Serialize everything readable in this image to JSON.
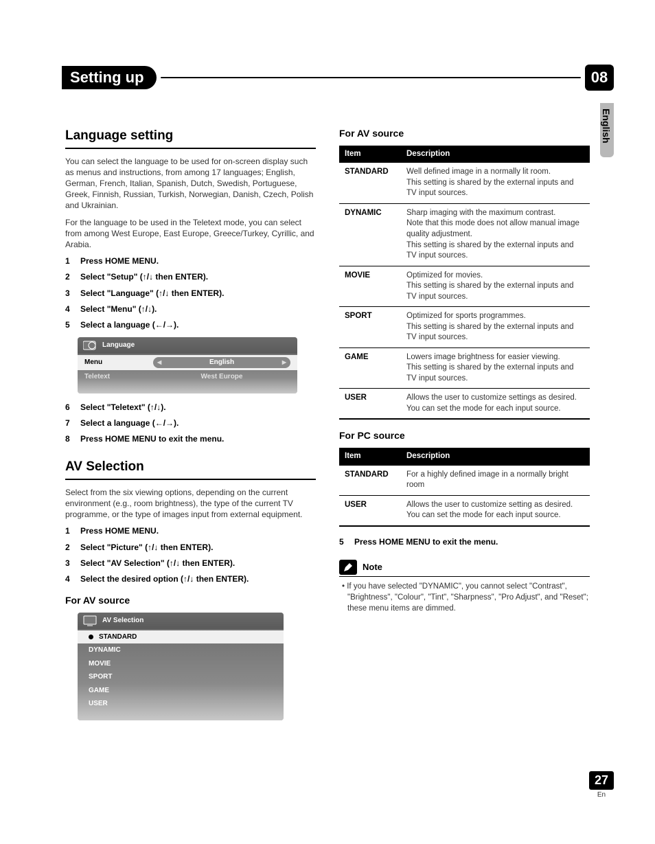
{
  "chapter": {
    "title": "Setting up",
    "number": "08"
  },
  "side_tab": "English",
  "language_setting": {
    "heading": "Language setting",
    "p1": "You can select the language to be used for on-screen display such as menus and instructions, from among 17 languages; English, German, French, Italian, Spanish, Dutch, Swedish, Portuguese, Greek, Finnish, Russian, Turkish, Norwegian, Danish, Czech, Polish and Ukrainian.",
    "p2": "For the language to be used in the Teletext mode, you can select from among West Europe, East Europe, Greece/Turkey, Cyrillic, and Arabia.",
    "steps": {
      "s1": "Press HOME MENU.",
      "s2": "Select \"Setup\" (↑/↓ then ENTER).",
      "s3": "Select \"Language\" (↑/↓ then ENTER).",
      "s4": "Select \"Menu\" (↑/↓).",
      "s5": "Select a language (←/→).",
      "s6": "Select \"Teletext\" (↑/↓).",
      "s7": "Select a language (←/→).",
      "s8": "Press HOME MENU to exit the menu."
    },
    "osd": {
      "title": "Language",
      "row1_label": "Menu",
      "row1_value": "English",
      "row2_label": "Teletext",
      "row2_value": "West Europe"
    }
  },
  "av_selection": {
    "heading": "AV Selection",
    "intro": "Select from the six viewing options, depending on the current environment (e.g., room brightness), the type of the current TV programme, or the type of images input from external equipment.",
    "steps": {
      "s1": "Press HOME MENU.",
      "s2": "Select \"Picture\" (↑/↓ then ENTER).",
      "s3": "Select \"AV Selection\" (↑/↓ then ENTER).",
      "s4": "Select the desired option (↑/↓ then ENTER)."
    },
    "sub_av": "For AV source",
    "osd": {
      "title": "AV Selection",
      "items": [
        "STANDARD",
        "DYNAMIC",
        "MOVIE",
        "SPORT",
        "GAME",
        "USER"
      ]
    }
  },
  "right": {
    "sub_av": "For AV source",
    "av_table": {
      "headers": {
        "item": "Item",
        "desc": "Description"
      },
      "rows": [
        {
          "item": "STANDARD",
          "desc": "Well defined image in a normally lit room.\nThis setting is shared by the external inputs and TV input sources."
        },
        {
          "item": "DYNAMIC",
          "desc": "Sharp imaging with the maximum contrast.\nNote that this mode does not allow manual image quality adjustment.\nThis setting is shared by the external inputs and TV input sources."
        },
        {
          "item": "MOVIE",
          "desc": "Optimized for movies.\nThis setting is shared by the external inputs and TV input sources."
        },
        {
          "item": "SPORT",
          "desc": "Optimized for sports programmes.\nThis setting is shared by the external inputs and TV input sources."
        },
        {
          "item": "GAME",
          "desc": "Lowers image brightness for easier viewing.\nThis setting is shared by the external inputs and TV input sources."
        },
        {
          "item": "USER",
          "desc": "Allows the user to customize settings as desired.\nYou can set the mode for each input source."
        }
      ]
    },
    "sub_pc": "For PC source",
    "pc_table": {
      "headers": {
        "item": "Item",
        "desc": "Description"
      },
      "rows": [
        {
          "item": "STANDARD",
          "desc": "For a highly defined image in a normally bright room"
        },
        {
          "item": "USER",
          "desc": "Allows the user to customize setting as desired.\nYou can set the mode for each input source."
        }
      ]
    },
    "step5": "Press HOME MENU to exit the menu.",
    "note_label": "Note",
    "note_text": "If you have selected \"DYNAMIC\", you cannot select \"Contrast\", \"Brightness\", \"Colour\", \"Tint\", \"Sharpness\", \"Pro Adjust\", and \"Reset\"; these menu items are dimmed."
  },
  "page": {
    "number": "27",
    "lang": "En"
  }
}
